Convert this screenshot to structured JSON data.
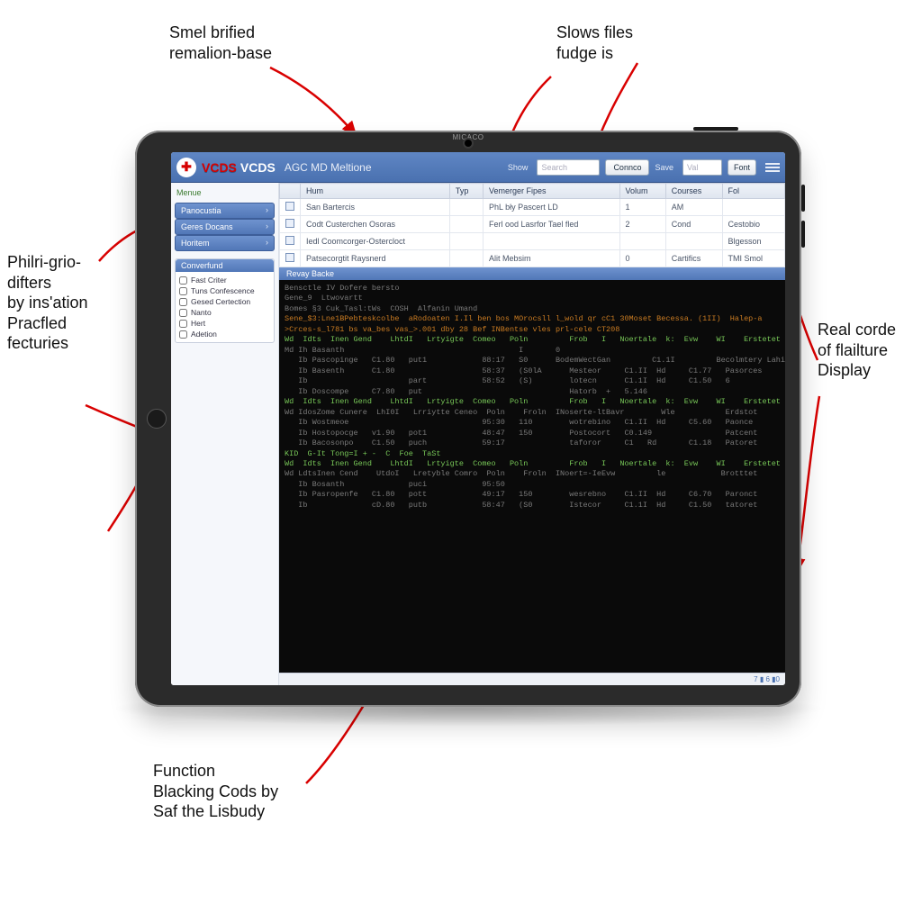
{
  "tablet": {
    "brand_label": "MICACO"
  },
  "annotations": {
    "top_left": "Smel brified\nremalion-base",
    "top_right": "Slows files\nfudge is",
    "left_1": "Philri-grio-\ndifters\nby ins'ation\nPracfled\nfecturies",
    "right": "Real corde\nof flailture\nDisplay",
    "bottom": "Function\nBlacking Cods by\nSaf the Lisbudy"
  },
  "header": {
    "brand_a": "VCDS",
    "brand_b": "VCDS",
    "subtitle": "AGC MD Meltione",
    "link_show": "Show",
    "search_placeholder": "Search",
    "link_save": "Save",
    "input2_placeholder": "Val",
    "btn_connect": "Connco",
    "btn_font": "Font"
  },
  "sidebar": {
    "menu_label": "Menue",
    "nav": [
      "Panocustia",
      "Geres Docans",
      "Horitem"
    ],
    "panel_title": "Converfund",
    "checks": [
      "Fast Criter",
      "Tuns Confescence",
      "Gesed Certection",
      "Nanto",
      "Hert",
      "Adetion"
    ]
  },
  "table": {
    "columns": [
      "",
      "Hum",
      "Typ",
      "Vemerger Fipes",
      "Volum",
      "Courses",
      "Fol"
    ],
    "rows": [
      [
        "",
        "San Bartercis",
        "",
        "PhL bły Pascert LD",
        "1",
        "AM",
        ""
      ],
      [
        "",
        "Codt Custerchen Osoras",
        "",
        "Ferl ood Lasrfor Tael fled",
        "2",
        "Cond",
        "Cestobio"
      ],
      [
        "",
        "Iedl Coomcorger-Ostercloct",
        "",
        "",
        "",
        "",
        "Blgesson"
      ],
      [
        "",
        "Patsecorgtit Raysnerd",
        "",
        "Alit Mebsim",
        "0",
        "Cartifics",
        "TMI Smol"
      ]
    ]
  },
  "terminal": {
    "title": "Revay Backe",
    "preamble": [
      "Bensctle IV Dofere bersto",
      "Gene_9  Ltwovartt",
      "Bomes §3 Cuk_Tasl:tWs  COSH  Alfanin Umand",
      "Sene_$3:Lne1BPebteskcolbe  aRodoaten I.Il ben bos MOrocsll l_wold qr cC1 30Moset Becessa. (1II)  Halep-a",
      ">Crces-s_l781 bs va_bes vas_>.001 dby 28 Bef INBentse vles prl-cele CT208"
    ],
    "col_header": "Wd  Idts  Inen Gend    LhtdI   Lrtyigte  Comeo   Poln         Frob   I   Noertale  k:  Evw    WI    Erstetet",
    "groups": [
      {
        "rows": [
          [
            "Md",
            "Ih",
            "Basanth",
            "",
            "",
            "",
            "",
            "I",
            "0",
            "",
            "",
            ""
          ],
          [
            "",
            "Ib",
            "Pascopinge",
            "C1.80",
            "put1",
            "",
            "88:17",
            "S0",
            "BodemWect",
            "Gan",
            "C1.1I",
            "Becolmtery Lahibe Siun"
          ],
          [
            "",
            "Ib",
            "Basenth",
            "C1.80",
            "",
            "",
            "58:37",
            "(S0lA",
            "",
            "Mesteor",
            "C1.II  Hd",
            "C1.77",
            "Pasorces"
          ],
          [
            "",
            "Ib",
            "",
            "",
            "part",
            "",
            "58:52",
            "(S)",
            "",
            "lotecn",
            "C1.1I  Hd",
            "C1.50",
            "6"
          ],
          [
            "",
            "Ib",
            "Doscompe",
            "C7.80",
            "put",
            "",
            "",
            "",
            "",
            "Hatorb  +",
            "5.146",
            "",
            ""
          ]
        ]
      },
      {
        "rows": [
          [
            "Wd",
            "Idos",
            "Zome Cunere",
            "LhI0I",
            "Lrriytte",
            "Ceneo",
            "Poln",
            "Froln  I",
            "Noserte-lt",
            "Bavr",
            "Wle",
            "Erdstot"
          ],
          [
            "",
            "Ib",
            "Wostmeoe",
            "",
            "",
            "",
            "95:30",
            "110",
            "",
            "wotrebino",
            "C1.II  Hd",
            "C5.60",
            "Paonce"
          ],
          [
            "",
            "Ib",
            "Hostopocge",
            "v1.90",
            "pot1",
            "",
            "48:47",
            "150",
            "",
            "Postocort",
            "C0.149",
            "",
            "Patcent"
          ],
          [
            "",
            "Ib",
            "Bacosonpo",
            "C1.50",
            "puch",
            "",
            "59:17",
            "",
            "",
            "taforor",
            "C1   Rd",
            "C1.18",
            "Patoret"
          ]
        ]
      },
      {
        "header": "KID  G-It Tong=I + -  C  Foe  TaSt",
        "rows": [
          [
            "Wd",
            "Ldts",
            "Inen Cend",
            "UtdoI",
            "Lretyble",
            "Comro",
            "Poln",
            "Froln  I",
            "Noert=-Ie",
            "Evw",
            "le",
            "Brotttet"
          ],
          [
            "",
            "Ib",
            "Bosanth",
            "",
            "puci",
            "",
            "95:50",
            "",
            "",
            "",
            "",
            ""
          ],
          [
            "",
            "Ib",
            "Pasropenfe",
            "C1.80",
            "pott",
            "",
            "49:17",
            "150",
            "",
            "wesrebno",
            "C1.II  Hd",
            "C6.70",
            "Paronct"
          ],
          [
            "",
            "Ib",
            "",
            "cD.80",
            "putb",
            "",
            "58:47",
            "(S0",
            "",
            "Istecor",
            "C1.1I  Hd",
            "C1.50",
            "tatoret"
          ]
        ]
      }
    ],
    "status_right": "7 ▮ 6 ▮0"
  }
}
